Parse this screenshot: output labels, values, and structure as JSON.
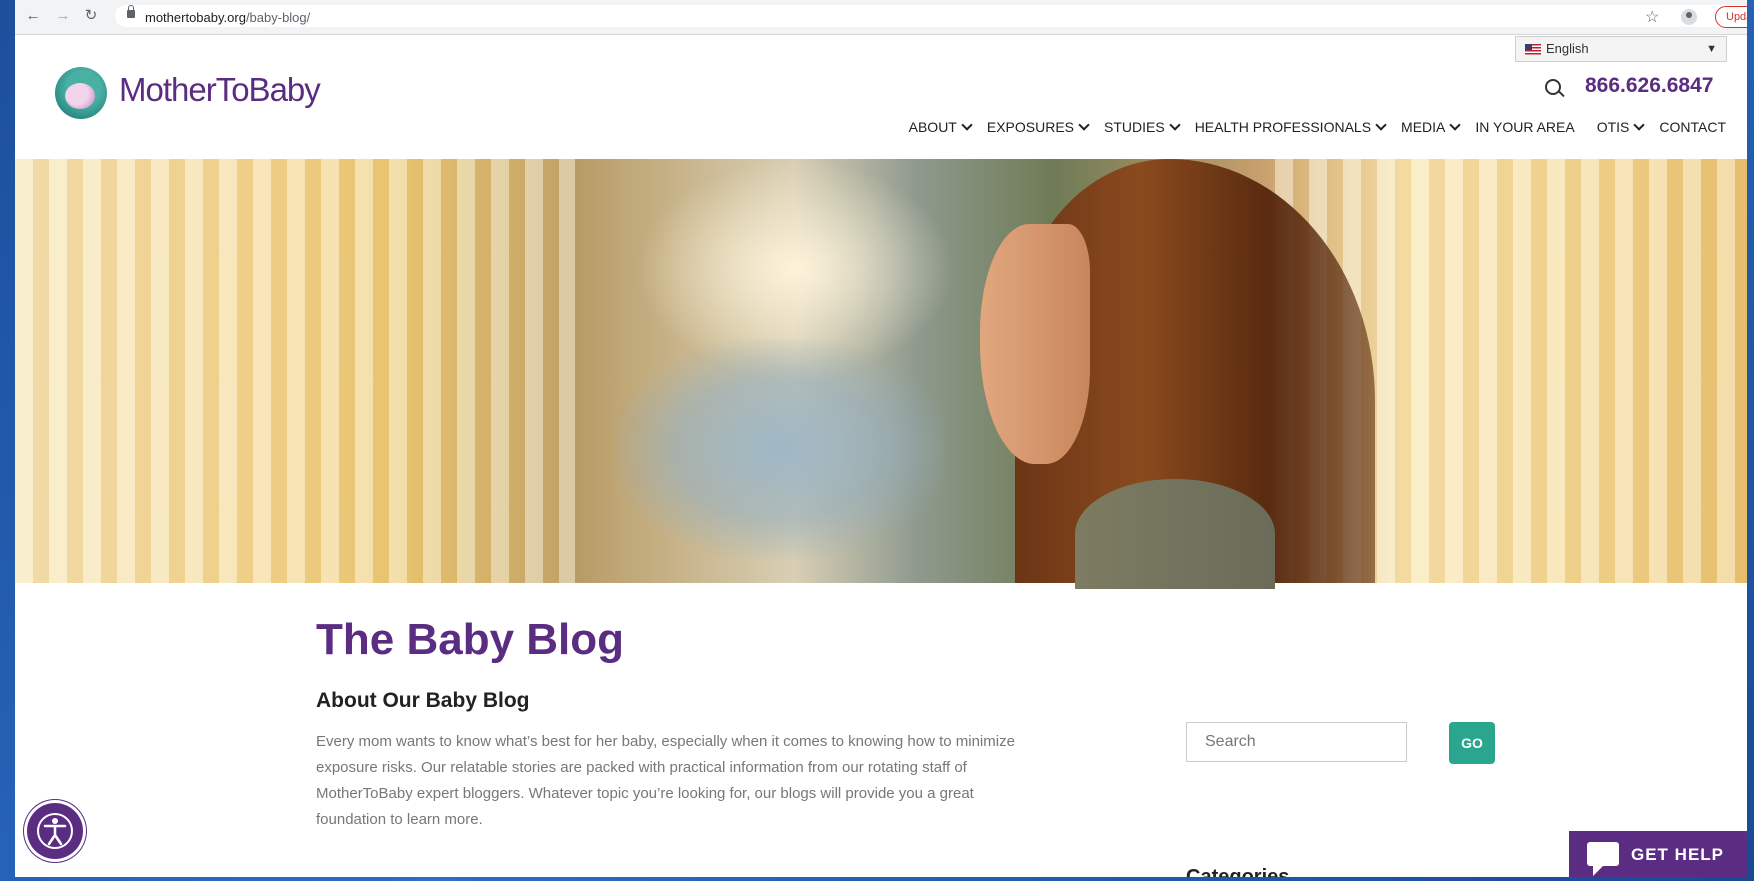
{
  "browser": {
    "url_domain": "mothertobaby.org",
    "url_path": "/baby-blog/",
    "update_label": "Update"
  },
  "header": {
    "language": "English",
    "logo_text": "MotherToBaby",
    "phone": "866.626.6847",
    "nav": [
      {
        "label": "ABOUT",
        "dropdown": true
      },
      {
        "label": "EXPOSURES",
        "dropdown": true
      },
      {
        "label": "STUDIES",
        "dropdown": true
      },
      {
        "label": "HEALTH PROFESSIONALS",
        "dropdown": true
      },
      {
        "label": "MEDIA",
        "dropdown": true
      },
      {
        "label": "IN YOUR AREA",
        "dropdown": false
      },
      {
        "label": "OTIS",
        "dropdown": true
      },
      {
        "label": "CONTACT",
        "dropdown": false
      }
    ]
  },
  "main": {
    "title": "The Baby Blog",
    "subtitle": "About Our Baby Blog",
    "description": "Every mom wants to know what’s best for her baby, especially when it comes to knowing how to minimize exposure risks. Our relatable stories are packed with practical information from our rotating staff of MotherToBaby expert bloggers. Whatever topic you’re looking for, our blogs will provide you a great foundation to learn more."
  },
  "sidebar": {
    "search_placeholder": "Search",
    "go_label": "GO",
    "categories_heading": "Categories"
  },
  "widgets": {
    "get_help_label": "GET HELP"
  },
  "colors": {
    "brand_purple": "#5b2d82",
    "accent_teal": "#2aa58e"
  }
}
